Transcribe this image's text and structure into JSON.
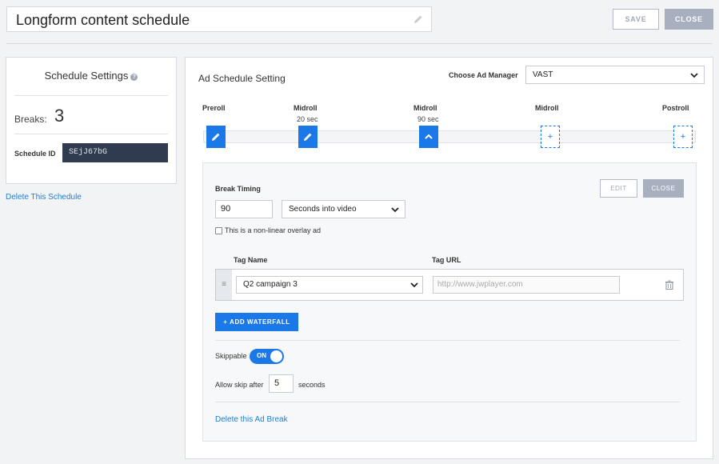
{
  "header": {
    "schedule_name": "Longform content schedule",
    "save_label": "SAVE",
    "close_label": "CLOSE",
    "edit_icon": "pencil-icon"
  },
  "left_panel": {
    "title": "Schedule Settings",
    "help_icon": "help-icon",
    "breaks_label": "Breaks:",
    "breaks_value": "3",
    "schedule_id_label": "Schedule ID",
    "schedule_id_value": "SEjJ67bG",
    "delete_link": "Delete This Schedule"
  },
  "ad_schedule": {
    "title": "Ad Schedule Setting",
    "ad_manager_label": "Choose Ad Manager",
    "ad_manager_value": "VAST",
    "timeline": [
      {
        "label": "Preroll",
        "sub": "",
        "state": "set",
        "icon": "pencil-icon"
      },
      {
        "label": "Midroll",
        "sub": "20 sec",
        "state": "set",
        "icon": "pencil-icon"
      },
      {
        "label": "Midroll",
        "sub": "90 sec",
        "state": "active",
        "icon": "chevron-up-icon"
      },
      {
        "label": "Midroll",
        "sub": "",
        "state": "empty",
        "icon": "plus-icon",
        "glyph": "+"
      },
      {
        "label": "Postroll",
        "sub": "",
        "state": "empty",
        "icon": "plus-icon",
        "glyph": "+"
      }
    ]
  },
  "break_detail": {
    "title": "Break Timing",
    "edit_label": "EDIT",
    "close_label": "CLOSE",
    "timing_value": "90",
    "timing_unit": "Seconds into video",
    "overlay_checkbox_label": "This is a non-linear overlay ad",
    "overlay_checked": false,
    "tag_name_header": "Tag Name",
    "tag_url_header": "Tag URL",
    "tag_rows": [
      {
        "drag_glyph": "≡",
        "tag_name": "Q2 campaign 3",
        "tag_url_placeholder": "http://www.jwplayer.com"
      }
    ],
    "add_waterfall_label": "+ ADD WATERFALL",
    "skippable_label": "Skippable",
    "skippable_state": "ON",
    "allow_skip_label": "Allow skip after",
    "allow_skip_value": "5",
    "seconds_label": "seconds",
    "delete_break_link": "Delete this Ad Break"
  },
  "colors": {
    "accent": "#1a78e8",
    "link": "#1d7fd8",
    "dark_field": "#2f3b4f",
    "muted_button": "#a8b0bf"
  }
}
